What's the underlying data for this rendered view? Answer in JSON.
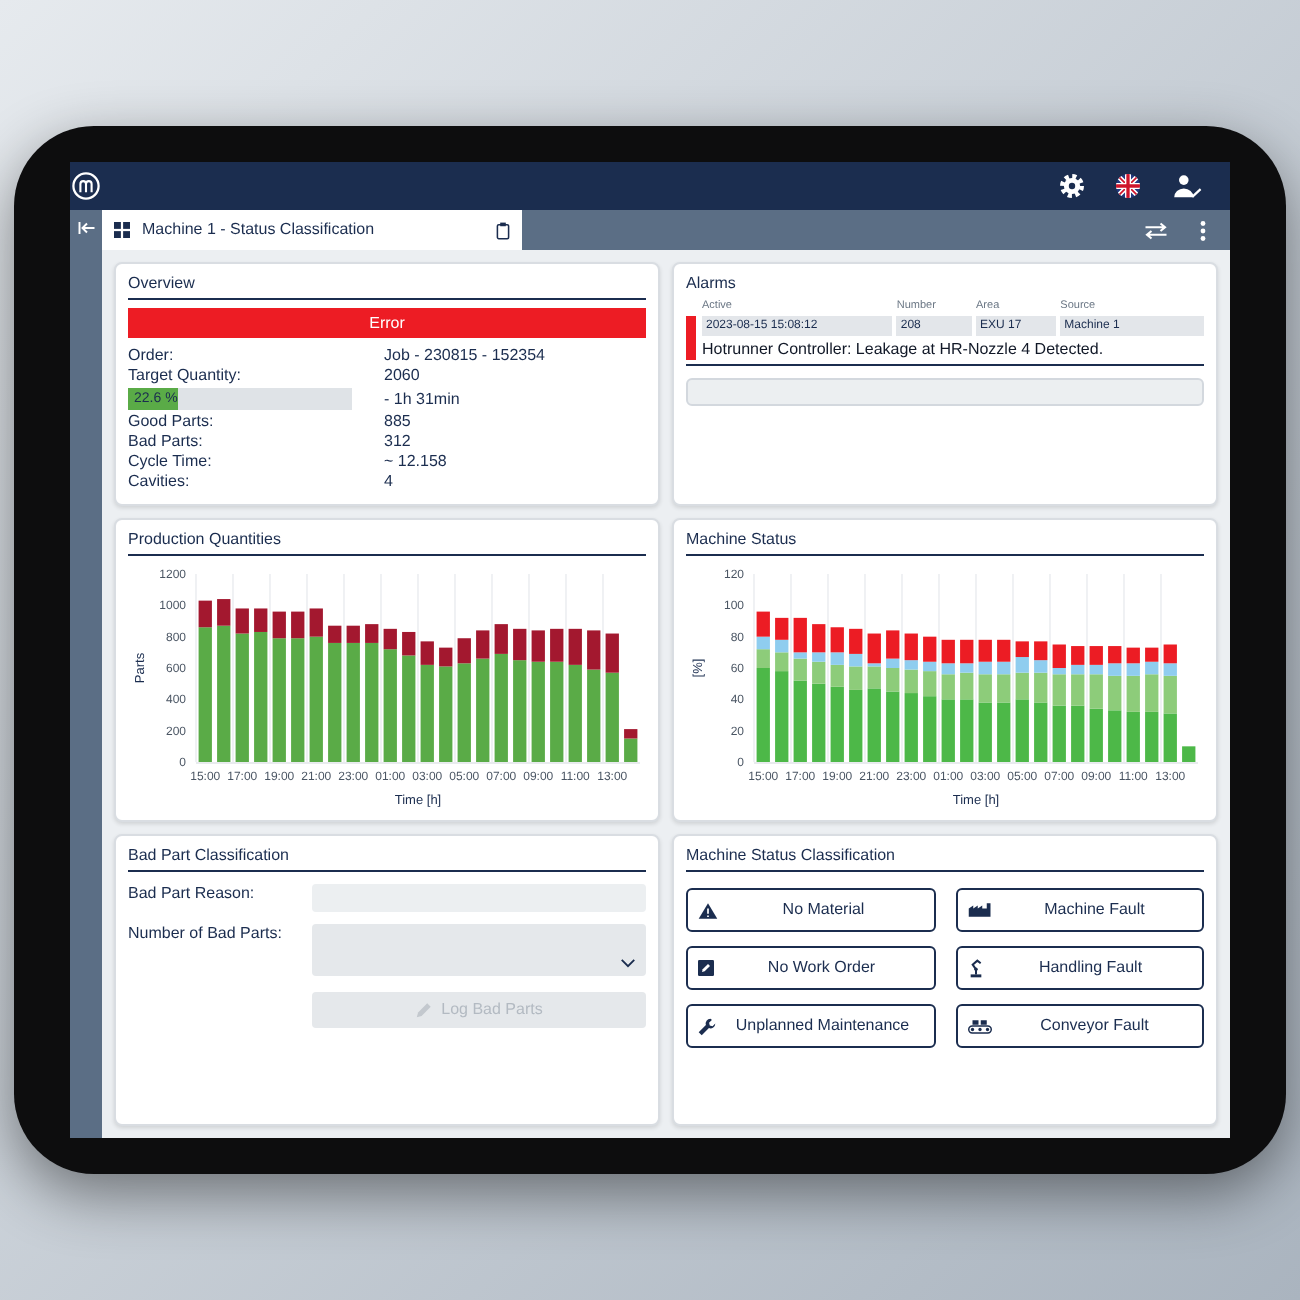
{
  "tab": {
    "title": "Machine 1 - Status Classification",
    "selected": true
  },
  "overview": {
    "title": "Overview",
    "status": {
      "kind": "error",
      "text": "Error"
    },
    "rows": [
      {
        "kind": "field",
        "label": "Order:",
        "value": "Job - 230815 - 152354"
      },
      {
        "kind": "field",
        "label": "Target Quantity:",
        "value": "2060"
      },
      {
        "kind": "progress",
        "text": "22.6 %",
        "level": 0.226,
        "value": "- 1h 31min"
      },
      {
        "kind": "field",
        "label": "Good Parts:",
        "value": "885"
      },
      {
        "kind": "field",
        "label": "Bad Parts:",
        "value": "312"
      },
      {
        "kind": "field",
        "label": "Cycle Time:",
        "value": "~ 12.158"
      },
      {
        "kind": "field",
        "label": "Cavities:",
        "value": "4"
      }
    ]
  },
  "alarms": {
    "title": "Alarms",
    "columns": [
      "Active",
      "Number",
      "Area",
      "Source"
    ],
    "rows": [
      {
        "color": "#ed1c24",
        "cells": [
          "2023-08-15 15:08:12",
          "208",
          "EXU 17",
          "Machine 1"
        ],
        "message": "Hotrunner Controller: Leakage at HR-Nozzle 4 Detected."
      }
    ]
  },
  "production_quantities": {
    "title": "Production Quantities",
    "chart_data": {
      "type": "bar",
      "stacked": true,
      "xlabel": "Time [h]",
      "ylabel": "Parts",
      "categories": [
        "15:00",
        null,
        "17:00",
        null,
        "19:00",
        null,
        "21:00",
        null,
        "23:00",
        null,
        "01:00",
        null,
        "03:00",
        null,
        "05:00",
        null,
        "07:00",
        null,
        "09:00",
        null,
        "11:00",
        null,
        "13:00",
        null
      ],
      "ylim": [
        0,
        1200
      ],
      "yticks": [
        0,
        200,
        400,
        600,
        800,
        1000,
        1200
      ],
      "series": [
        {
          "color": "#5aab47",
          "values": [
            860,
            870,
            820,
            830,
            790,
            790,
            800,
            760,
            760,
            760,
            720,
            680,
            620,
            610,
            630,
            660,
            690,
            650,
            640,
            640,
            620,
            590,
            570,
            150
          ]
        },
        {
          "color": "#a3182f",
          "values": [
            170,
            170,
            160,
            150,
            170,
            170,
            180,
            110,
            110,
            120,
            130,
            150,
            150,
            120,
            160,
            180,
            190,
            200,
            200,
            210,
            230,
            250,
            250,
            60
          ]
        }
      ]
    }
  },
  "machine_status": {
    "title": "Machine Status",
    "chart_data": {
      "type": "bar",
      "stacked": true,
      "xlabel": "Time [h]",
      "ylabel": "[%]",
      "categories": [
        "15:00",
        null,
        "17:00",
        null,
        "19:00",
        null,
        "21:00",
        null,
        "23:00",
        null,
        "01:00",
        null,
        "03:00",
        null,
        "05:00",
        null,
        "07:00",
        null,
        "09:00",
        null,
        "11:00",
        null,
        "13:00",
        null
      ],
      "ylim": [
        0,
        120
      ],
      "yticks": [
        0,
        20,
        40,
        60,
        80,
        100,
        120
      ],
      "series": [
        {
          "color": "#4db848",
          "values": [
            60,
            58,
            52,
            50,
            48,
            46,
            47,
            45,
            44,
            42,
            40,
            40,
            38,
            38,
            40,
            38,
            36,
            36,
            34,
            33,
            32,
            32,
            31,
            10
          ]
        },
        {
          "color": "#8dcc7a",
          "values": [
            12,
            12,
            14,
            14,
            14,
            15,
            14,
            15,
            15,
            16,
            16,
            17,
            18,
            18,
            17,
            19,
            20,
            20,
            22,
            22,
            23,
            24,
            24,
            0
          ]
        },
        {
          "color": "#8fcdef",
          "values": [
            8,
            8,
            4,
            6,
            8,
            8,
            2,
            6,
            6,
            6,
            7,
            6,
            8,
            8,
            10,
            8,
            4,
            6,
            6,
            8,
            8,
            8,
            8,
            0
          ]
        },
        {
          "color": "#ec1c24",
          "values": [
            16,
            14,
            22,
            18,
            16,
            16,
            19,
            18,
            17,
            16,
            15,
            15,
            14,
            14,
            10,
            12,
            15,
            12,
            12,
            11,
            10,
            9,
            12,
            0
          ]
        }
      ]
    }
  },
  "bad_part_classification": {
    "title": "Bad Part Classification",
    "fields": [
      {
        "kind": "input",
        "label": "Bad Part Reason:"
      },
      {
        "kind": "dropdown",
        "label": "Number of Bad Parts:"
      }
    ],
    "button": {
      "label": "Log Bad Parts",
      "disabled": true
    }
  },
  "machine_status_classification": {
    "title": "Machine Status Classification",
    "buttons": [
      "No Material",
      "No Work Order",
      "Unplanned Maintenance",
      "Machine Fault",
      "Handling Fault",
      "Conveyor Fault"
    ]
  }
}
